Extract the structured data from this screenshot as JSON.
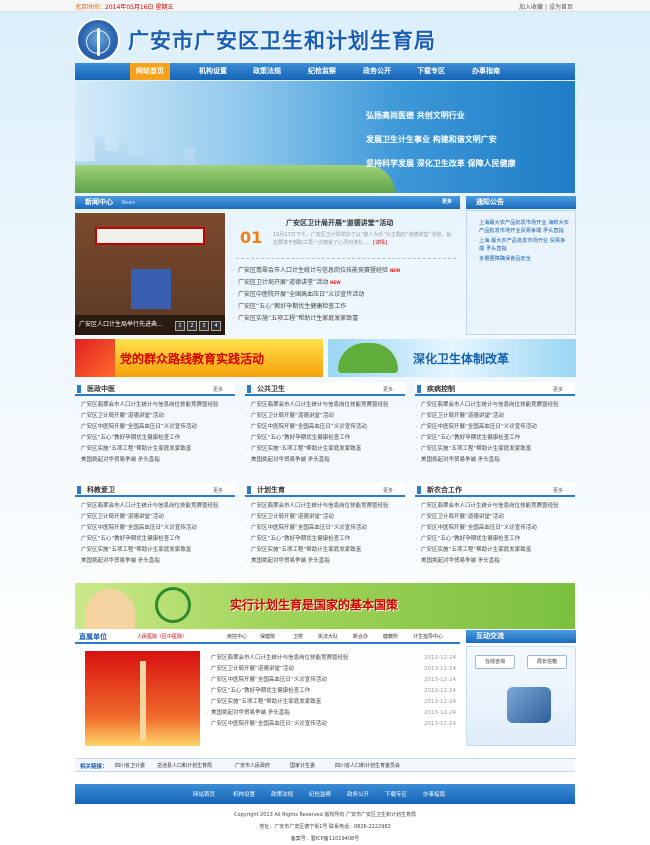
{
  "topbar": {
    "date_label": "北京时间：",
    "date": "2014年05月16日 星期五",
    "links": [
      "加入收藏",
      "设为首页"
    ]
  },
  "header": {
    "title": "广安市广安区卫生和计划生育局"
  },
  "nav": [
    "网站首页",
    "机构设置",
    "政策法规",
    "纪检监察",
    "政务公开",
    "下载专区",
    "办事指南"
  ],
  "banner": {
    "slogans": [
      "弘扬高尚医德  共创文明行业",
      "发展卫生计生事业  构建和谐文明广安",
      "坚持科学发展  深化卫生改革  保障人民健康"
    ]
  },
  "news_center": {
    "title": "新闻中心",
    "subtitle": "News",
    "more": "更多",
    "photo_caption": "广安区人口计生局举行先进典...",
    "pager": [
      "1",
      "2",
      "3",
      "4"
    ],
    "headline": {
      "day": "01",
      "title": "广安区卫计局开展“道德讲堂”活动",
      "summary": "10月17日下午，广安区卫计局举办了以“敬人为乐”为主题的“道德讲堂”活动，旨在要求干部职工再一次接受了心灵的洗礼……",
      "detail": "[详情]"
    },
    "items": [
      "广安区翡翠会市人口计生统计与信息岗位技能竞赛暨经验",
      "广安区卫计局开展“道德讲堂”活动",
      "广安区中医院开展“全国高血压日”义诊宣传活动",
      "广安区“五心”教好孕期优生健康检查工作",
      "广安区实施“五项工程”帮助计生家庭发家致富"
    ],
    "new_tag": "NEW"
  },
  "notice": {
    "title": "通知公告",
    "items": [
      "上海最大农产品批发市场开业 海鲜大农产品批发市场开业贸易争端  矛头直指",
      "上海 最大农产品批发市场开业 贸易争端  矛头直指",
      "多量围障确保食品安全"
    ]
  },
  "ads": {
    "left": "党的群众路线教育实践活动",
    "right": "深化卫生体制改革"
  },
  "columns": [
    {
      "title": "医政中医",
      "more": "更多"
    },
    {
      "title": "公共卫生",
      "more": "更多"
    },
    {
      "title": "疾病控制",
      "more": "更多"
    },
    {
      "title": "科教爱卫",
      "more": "更多"
    },
    {
      "title": "计划生育",
      "more": "更多"
    },
    {
      "title": "新农合工作",
      "more": "更多"
    }
  ],
  "column_items": [
    "广安区翡翠会市人口计生统计与信息岗位技能竞赛暨经验",
    "广安区卫计局开展“道德讲堂”活动",
    "广安区中医院开展“全国高血压日”义诊宣传活动",
    "广安区“五心”教好孕期优生健康检查工作",
    "广安区实施“五项工程”帮助计生家庭发家致富",
    "美国挑起对华贸易争端  矛头直指"
  ],
  "green_banner": {
    "text": "实行计划生育是国家的基本国策"
  },
  "direct_units": {
    "label": "直属单位",
    "tabs": [
      "人民医院（区中医院）",
      "疾控中心",
      "保健院",
      "卫校",
      "执法大队",
      "新合办",
      "健教所",
      "计生指导中心"
    ],
    "items": [
      {
        "text": "广安区翡翠会市人口计生统计与信息岗位技能竞赛暨经验",
        "date": "2013-12-24"
      },
      {
        "text": "广安区卫计局开展“道德讲堂”活动",
        "date": "2013-12-24"
      },
      {
        "text": "广安区中医院开展“全国高血压日”义诊宣传活动",
        "date": "2013-12-24"
      },
      {
        "text": "广安区“五心”教好孕期优生健康检查工作",
        "date": "2013-12-24"
      },
      {
        "text": "广安区实施“五项工程”帮助计生家庭发家致富",
        "date": "2013-12-24"
      },
      {
        "text": "美国挑起对华贸易争端  矛头直指",
        "date": "2013-12-24"
      },
      {
        "text": "广安区中医院开展“全国高血压日”义诊宣传活动",
        "date": "2013-12-24"
      }
    ]
  },
  "side_panel": {
    "title": "互动交流",
    "buttons": [
      "在线咨询",
      "局长信箱"
    ]
  },
  "friend_links": {
    "label": "相关链接：",
    "items": [
      "四川省卫计委",
      "岳池县人口和计划生育局",
      "广安市人民政府",
      "国家计生委",
      "四川省人口和计划生育委员会"
    ]
  },
  "footer": {
    "nav": [
      "网站首页",
      "机构设置",
      "政策法规",
      "纪检监察",
      "政务公开",
      "下载专区",
      "办事指南"
    ],
    "copyright": "Copyright 2013 All Rights Reserved 版权所有 广安市广安区卫生和计划生育局",
    "address": "地址：广安市广安区德宁街1号  联系电话：0826-2222982",
    "icp": "备案号：蜀ICP备11019408号"
  }
}
